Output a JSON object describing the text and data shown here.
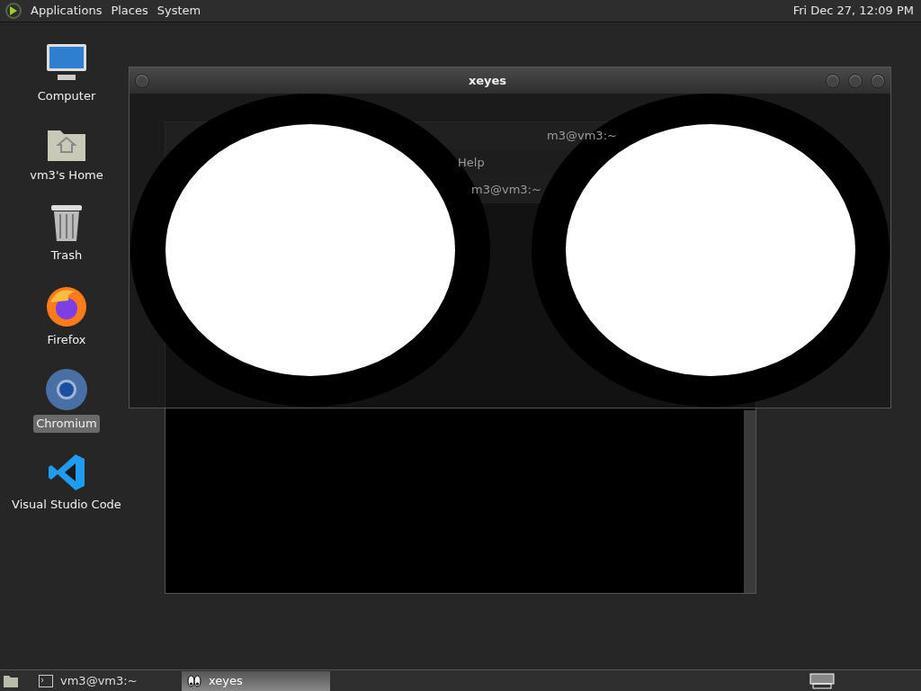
{
  "top_panel": {
    "menus": [
      "Applications",
      "Places",
      "System"
    ],
    "clock": "Fri Dec 27, 12:09 PM"
  },
  "desktop_icons": [
    {
      "kind": "computer",
      "label": "Computer",
      "selected": false
    },
    {
      "kind": "home",
      "label": "vm3's Home",
      "selected": false
    },
    {
      "kind": "trash",
      "label": "Trash",
      "selected": false
    },
    {
      "kind": "firefox",
      "label": "Firefox",
      "selected": false
    },
    {
      "kind": "chromium",
      "label": "Chromium",
      "selected": true
    },
    {
      "kind": "vscode",
      "label": "Visual Studio Code",
      "selected": false
    }
  ],
  "terminal_window": {
    "title": "m3@vm3:~",
    "menu": [
      "Help"
    ],
    "tab": "m3@vm3:~"
  },
  "xeyes_window": {
    "title": "xeyes"
  },
  "taskbar": [
    {
      "kind": "terminal",
      "label": "vm3@vm3:~",
      "selected": false
    },
    {
      "kind": "eyes",
      "label": "xeyes",
      "selected": true
    }
  ]
}
